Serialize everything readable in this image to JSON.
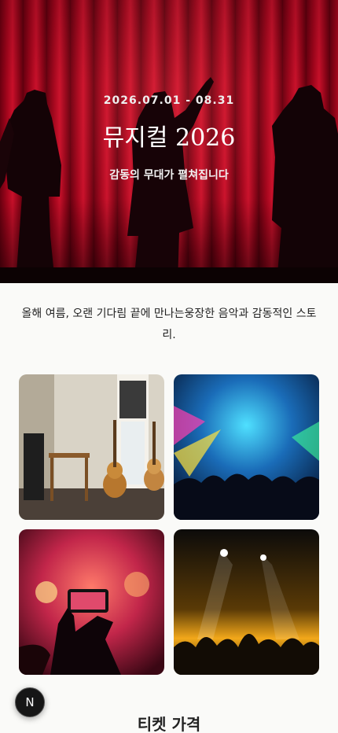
{
  "hero": {
    "date": "2026.07.01 - 08.31",
    "title": "뮤지컬 2026",
    "subtitle": "감동의 무대가 펼쳐집니다"
  },
  "intro": {
    "text": "올해 여름, 오랜 기다림 끝에 만나는웅장한 음악과 감동적인 스토리."
  },
  "gallery": {
    "images": [
      {
        "icon": "guitar-studio-image"
      },
      {
        "icon": "concert-crowd-lights-image"
      },
      {
        "icon": "phone-recording-concert-image"
      },
      {
        "icon": "stage-lights-crowd-image"
      }
    ]
  },
  "tickets": {
    "title": "티켓 가격"
  },
  "fab": {
    "label": "N"
  },
  "colors": {
    "curtain": "#a3051c",
    "background": "#fafaf8",
    "fab": "#161616"
  }
}
